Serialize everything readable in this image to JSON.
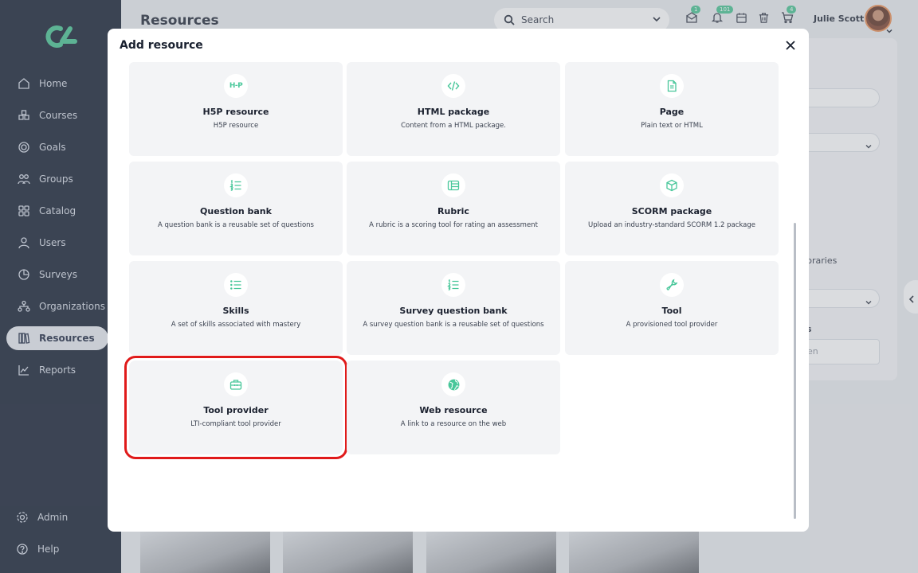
{
  "app": {
    "page_title": "Resources"
  },
  "sidebar": {
    "items": [
      {
        "label": "Home",
        "icon": "home-icon"
      },
      {
        "label": "Courses",
        "icon": "courses-icon"
      },
      {
        "label": "Goals",
        "icon": "goals-icon"
      },
      {
        "label": "Groups",
        "icon": "groups-icon"
      },
      {
        "label": "Catalog",
        "icon": "catalog-icon"
      },
      {
        "label": "Users",
        "icon": "users-icon"
      },
      {
        "label": "Surveys",
        "icon": "surveys-icon"
      },
      {
        "label": "Organizations",
        "icon": "organizations-icon"
      },
      {
        "label": "Resources",
        "icon": "resources-icon",
        "active": true
      },
      {
        "label": "Reports",
        "icon": "reports-icon"
      }
    ],
    "bottom": [
      {
        "label": "Admin",
        "icon": "gear-icon"
      },
      {
        "label": "Help",
        "icon": "help-icon"
      }
    ]
  },
  "header": {
    "search_placeholder": "Search",
    "badges": {
      "inbox": "1",
      "notifications": "101",
      "cart": "4"
    },
    "user_name": "Julie Scott"
  },
  "background": {
    "text_libraries": "braries",
    "text_s": "s",
    "text_en": "en"
  },
  "modal": {
    "title": "Add resource",
    "cards": [
      {
        "title": "H5P resource",
        "desc": "H5P resource",
        "icon": "h5p-icon",
        "icon_text": "H-P"
      },
      {
        "title": "HTML package",
        "desc": "Content from a HTML package.",
        "icon": "code-icon"
      },
      {
        "title": "Page",
        "desc": "Plain text or HTML",
        "icon": "page-icon"
      },
      {
        "title": "Question bank",
        "desc": "A question bank is a reusable set of questions",
        "icon": "numbered-list-icon"
      },
      {
        "title": "Rubric",
        "desc": "A rubric is a scoring tool for rating an assessment",
        "icon": "rubric-icon"
      },
      {
        "title": "SCORM package",
        "desc": "Upload an industry-standard SCORM 1.2 package",
        "icon": "cube-icon"
      },
      {
        "title": "Skills",
        "desc": "A set of skills associated with mastery",
        "icon": "list-icon"
      },
      {
        "title": "Survey question bank",
        "desc": "A survey question bank is a reusable set of questions",
        "icon": "numbered-list-icon"
      },
      {
        "title": "Tool",
        "desc": "A provisioned tool provider",
        "icon": "wrench-icon"
      },
      {
        "title": "Tool provider",
        "desc": "LTI-compliant tool provider",
        "icon": "toolbox-icon"
      },
      {
        "title": "Web resource",
        "desc": "A link to a resource on the web",
        "icon": "globe-icon"
      }
    ]
  },
  "colors": {
    "accent": "#48c79a",
    "sidebar_bg": "#0c1629",
    "highlight": "#e01a1a"
  }
}
